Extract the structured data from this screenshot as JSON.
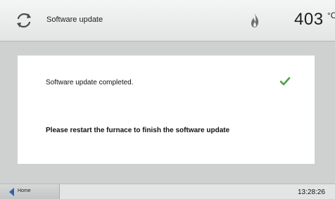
{
  "header": {
    "title": "Software update",
    "temperature": "403",
    "temperature_unit": "°C",
    "refresh_icon": "refresh-icon",
    "status_icon": "flame-icon"
  },
  "dialog": {
    "completed_message": "Software update completed.",
    "status_icon": "checkmark-icon",
    "restart_message": "Please restart the furnace to finish the software update"
  },
  "footer": {
    "home_label": "Home",
    "home_icon": "back-arrow-icon",
    "time": "13:28:26"
  },
  "colors": {
    "check": "#47a34b",
    "home_arrow": "#2f63b0",
    "flame": "#6d6f70"
  }
}
